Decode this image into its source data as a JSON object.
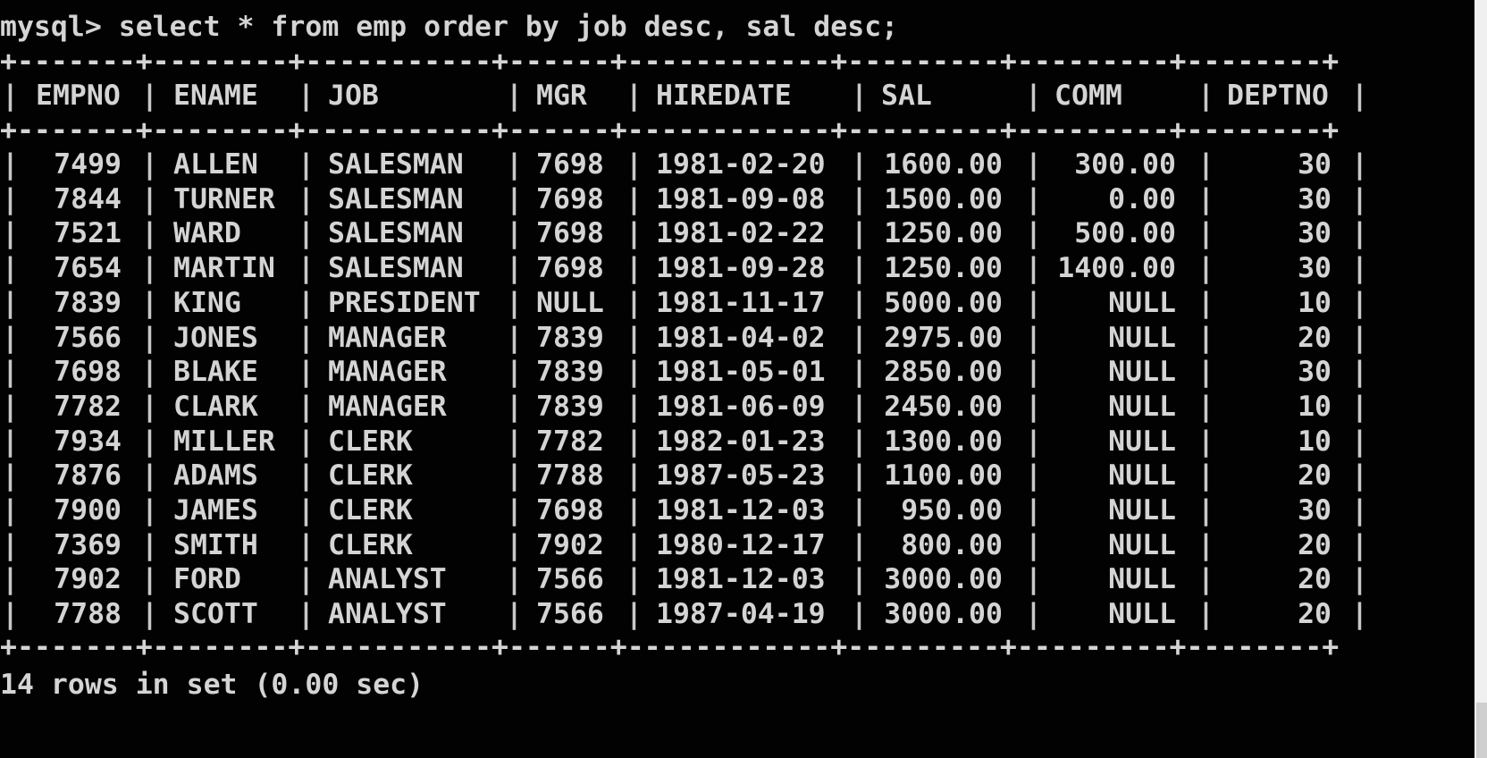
{
  "terminal": {
    "prompt": "mysql> select * from emp order by job desc, sal desc;",
    "border": "+-------+--------+-----------+------+------------+---------+---------+--------+",
    "footer": "14 rows in set (0.00 sec)"
  },
  "colors": {
    "background": "#020202",
    "text": "#d4d4d4",
    "scrollbar": "#f0f0f0"
  },
  "table": {
    "columns": [
      "EMPNO",
      "ENAME",
      "JOB",
      "MGR",
      "HIREDATE",
      "SAL",
      "COMM",
      "DEPTNO"
    ],
    "rows": [
      [
        "7499",
        "ALLEN",
        "SALESMAN",
        "7698",
        "1981-02-20",
        "1600.00",
        "300.00",
        "30"
      ],
      [
        "7844",
        "TURNER",
        "SALESMAN",
        "7698",
        "1981-09-08",
        "1500.00",
        "0.00",
        "30"
      ],
      [
        "7521",
        "WARD",
        "SALESMAN",
        "7698",
        "1981-02-22",
        "1250.00",
        "500.00",
        "30"
      ],
      [
        "7654",
        "MARTIN",
        "SALESMAN",
        "7698",
        "1981-09-28",
        "1250.00",
        "1400.00",
        "30"
      ],
      [
        "7839",
        "KING",
        "PRESIDENT",
        "NULL",
        "1981-11-17",
        "5000.00",
        "NULL",
        "10"
      ],
      [
        "7566",
        "JONES",
        "MANAGER",
        "7839",
        "1981-04-02",
        "2975.00",
        "NULL",
        "20"
      ],
      [
        "7698",
        "BLAKE",
        "MANAGER",
        "7839",
        "1981-05-01",
        "2850.00",
        "NULL",
        "30"
      ],
      [
        "7782",
        "CLARK",
        "MANAGER",
        "7839",
        "1981-06-09",
        "2450.00",
        "NULL",
        "10"
      ],
      [
        "7934",
        "MILLER",
        "CLERK",
        "7782",
        "1982-01-23",
        "1300.00",
        "NULL",
        "10"
      ],
      [
        "7876",
        "ADAMS",
        "CLERK",
        "7788",
        "1987-05-23",
        "1100.00",
        "NULL",
        "20"
      ],
      [
        "7900",
        "JAMES",
        "CLERK",
        "7698",
        "1981-12-03",
        "950.00",
        "NULL",
        "30"
      ],
      [
        "7369",
        "SMITH",
        "CLERK",
        "7902",
        "1980-12-17",
        "800.00",
        "NULL",
        "20"
      ],
      [
        "7902",
        "FORD",
        "ANALYST",
        "7566",
        "1981-12-03",
        "3000.00",
        "NULL",
        "20"
      ],
      [
        "7788",
        "SCOTT",
        "ANALYST",
        "7566",
        "1987-04-19",
        "3000.00",
        "NULL",
        "20"
      ]
    ]
  }
}
